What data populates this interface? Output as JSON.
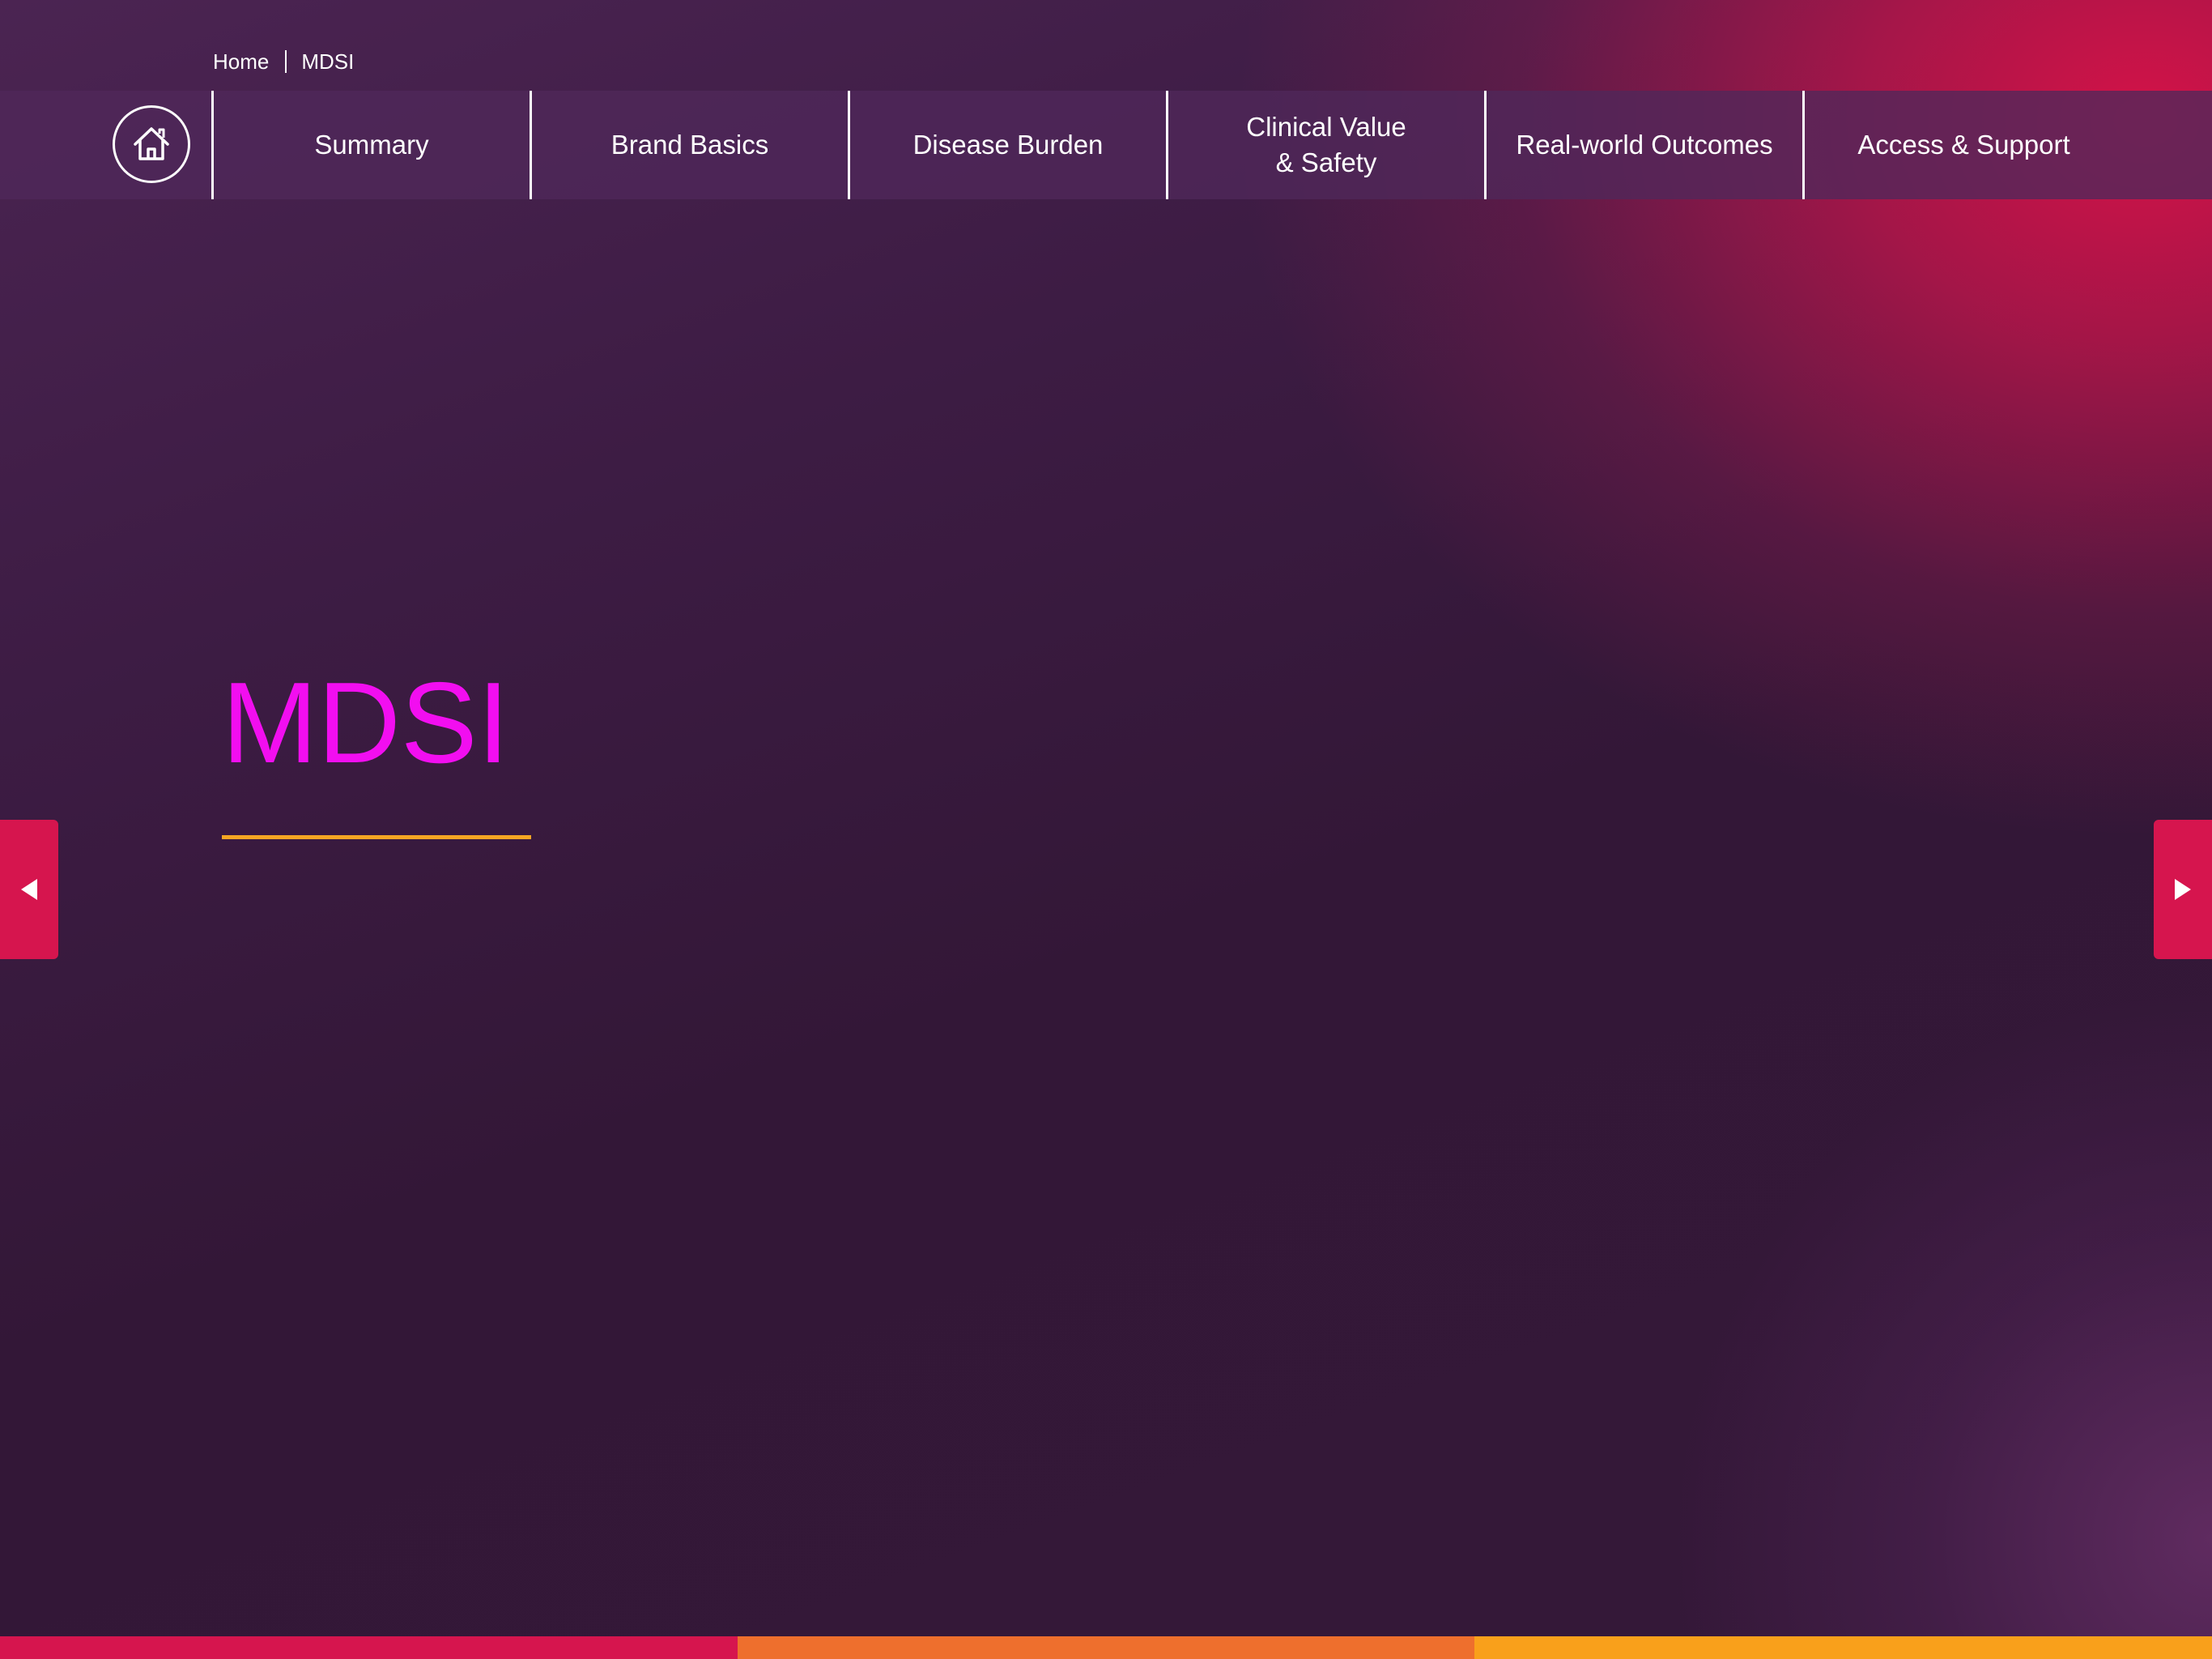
{
  "breadcrumb": {
    "home": "Home",
    "current": "MDSI"
  },
  "nav": {
    "home_icon": "home-icon",
    "items": [
      {
        "label": "Summary"
      },
      {
        "label": "Brand Basics"
      },
      {
        "label": "Disease Burden"
      },
      {
        "label": "Clinical Value\n& Safety"
      },
      {
        "label": "Real-world Outcomes"
      },
      {
        "label": "Access & Support"
      }
    ]
  },
  "page": {
    "title": "MDSI"
  },
  "arrows": {
    "prev_icon": "triangle-left-icon",
    "next_icon": "triangle-right-icon"
  },
  "colors": {
    "title": "#f20ef0",
    "accent_rule": "#f5a623",
    "arrow_bg": "#d6154e",
    "footer": [
      "#d6154e",
      "#ee6f2d",
      "#f9a01b"
    ]
  }
}
